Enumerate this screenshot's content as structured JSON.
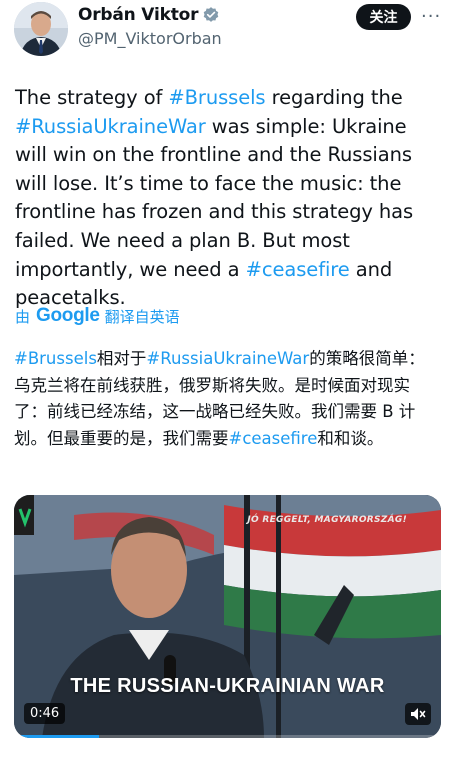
{
  "author": {
    "name": "Orbán Viktor",
    "handle": "@PM_ViktorOrban",
    "verified": true
  },
  "actions": {
    "follow_label": "关注",
    "more_icon": "more-dots-icon"
  },
  "tweet": {
    "p1": "The strategy of ",
    "tag_brussels": "#Brussels",
    "p2": " regarding the ",
    "tag_war": "#RussiaUkraineWar",
    "p3": " was simple: Ukraine will win on the frontline and the Russians will lose. It’s time to face the music: the frontline has frozen and this strategy has failed. We need a plan B. But most importantly, we need a ",
    "tag_ceasefire": "#ceasefire",
    "p4": " and peacetalks."
  },
  "translation": {
    "prefix": "由",
    "provider": "Google",
    "action": "翻译自英语"
  },
  "translated": {
    "tag_brussels": "#Brussels",
    "t1": "相对于",
    "tag_war": "#RussiaUkraineWar",
    "t2": "的策略很简单：乌克兰将在前线获胜，俄罗斯将失败。是时候面对现实了：前线已经冻结，这一战略已经失败。我们需要 B 计划。但最重要的是，我们需要",
    "tag_ceasefire": "#ceasefire",
    "t3": "和和谈。"
  },
  "video": {
    "caption": "THE RUSSIAN-UKRAINIAN WAR",
    "channel": "JÓ REGGELT, MAGYARORSZÁG!",
    "duration": "0:46",
    "progress": 0.2
  },
  "colors": {
    "accent": "#1d9bf0",
    "text": "#0f1419",
    "muted": "#536471"
  }
}
